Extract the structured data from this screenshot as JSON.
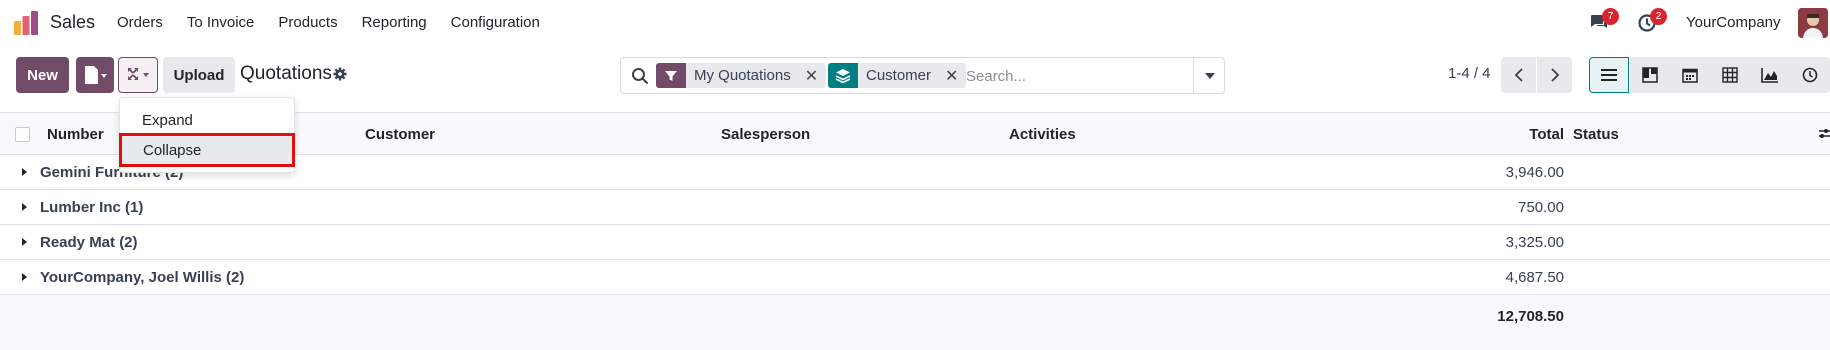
{
  "app": {
    "name": "Sales",
    "menu": [
      "Orders",
      "To Invoice",
      "Products",
      "Reporting",
      "Configuration"
    ],
    "messages_badge": "7",
    "activities_badge": "2",
    "company": "YourCompany"
  },
  "control_panel": {
    "new_label": "New",
    "upload_label": "Upload",
    "title": "Quotations"
  },
  "search": {
    "facets": [
      {
        "label": "My Quotations",
        "icon": "filter-icon",
        "color": "#714b67"
      },
      {
        "label": "Customer",
        "icon": "layers-icon",
        "color": "#017e84"
      }
    ],
    "placeholder": "Search..."
  },
  "pager": {
    "value": "1-4 / 4"
  },
  "views": [
    "list-view",
    "kanban-view",
    "calendar-view",
    "pivot-view",
    "graph-view",
    "activity-view"
  ],
  "dropdown": {
    "items": [
      "Expand",
      "Collapse"
    ],
    "highlighted": "Collapse"
  },
  "table": {
    "headers": {
      "number": "Number",
      "customer": "Customer",
      "salesperson": "Salesperson",
      "activities": "Activities",
      "total": "Total",
      "status": "Status"
    },
    "groups": [
      {
        "name": "Gemini Furniture (2)",
        "total": "3,946.00"
      },
      {
        "name": "Lumber Inc (1)",
        "total": "750.00"
      },
      {
        "name": "Ready Mat (2)",
        "total": "3,325.00"
      },
      {
        "name": "YourCompany, Joel Willis (2)",
        "total": "4,687.50"
      }
    ],
    "grand_total": "12,708.50"
  },
  "colors": {
    "primary": "#714b67",
    "accent": "#017e84",
    "badge": "#d9262e",
    "highlight_border": "#e01010"
  }
}
